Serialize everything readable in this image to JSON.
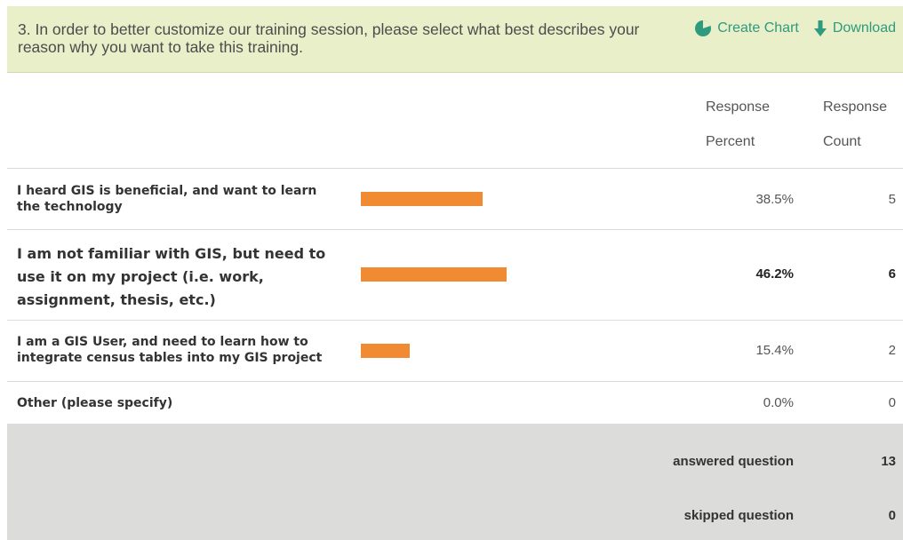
{
  "question": {
    "text": "3. In order to better customize our training session, please select what best describes your reason why you want to take this training."
  },
  "actions": {
    "create_chart": "Create Chart",
    "download": "Download"
  },
  "colors": {
    "accent": "#2f9a7d",
    "bar": "#f08a33",
    "header_bg": "#e8efc9",
    "footer_bg": "#dcdcda"
  },
  "columns": {
    "percent": "Response Percent",
    "count": "Response Count"
  },
  "rows": [
    {
      "label": "I heard GIS is beneficial, and want to learn the technology",
      "percent": "38.5%",
      "count": "5",
      "fraction": 0.385
    },
    {
      "label": "I am not familiar with GIS, but need to use it on my project (i.e. work, assignment, thesis, etc.)",
      "percent": "46.2%",
      "count": "6",
      "fraction": 0.462
    },
    {
      "label": "I am a GIS User, and need to learn how to integrate census tables into my GIS project",
      "percent": "15.4%",
      "count": "2",
      "fraction": 0.154
    },
    {
      "label": "Other (please specify)",
      "percent": "0.0%",
      "count": "0",
      "fraction": 0
    }
  ],
  "summary": {
    "answered_label": "answered question",
    "answered_value": "13",
    "skipped_label": "skipped question",
    "skipped_value": "0"
  }
}
